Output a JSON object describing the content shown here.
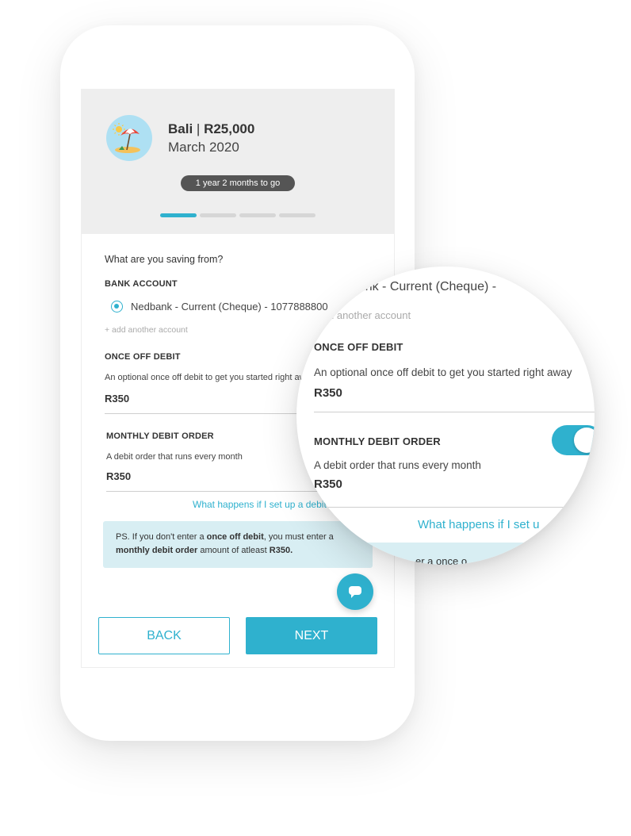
{
  "goal": {
    "name": "Bali",
    "amount": "R25,000",
    "date": "March 2020",
    "time_left": "1 year 2 months to go",
    "icon": "beach-umbrella-icon",
    "progress": {
      "current_step": 1,
      "total_steps": 4
    }
  },
  "form": {
    "question": "What are you saving from?",
    "bank_account": {
      "label": "BANK ACCOUNT",
      "selected": "Nedbank - Current (Cheque) - 1077888800",
      "add_link": "+ add another account"
    },
    "once_off": {
      "label": "ONCE OFF DEBIT",
      "help": "An optional once off debit to get you started right away",
      "value": "R350"
    },
    "monthly": {
      "label": "MONTHLY DEBIT ORDER",
      "help": "A debit order that runs every month",
      "value": "R350",
      "enabled": true
    },
    "info_link": "What happens if I set up a debit order?",
    "note": {
      "prefix": "PS. If you don't enter a ",
      "bold1": "once off debit",
      "middle": ", you must enter a ",
      "bold2": "monthly debit order",
      "suffix": " amount of atleast ",
      "bold3": "R350."
    }
  },
  "buttons": {
    "back": "BACK",
    "next": "NEXT",
    "chat_icon": "chat-bubble-icon"
  },
  "magnifier": {
    "account_fragment": "dbank - Current (Cheque) -",
    "add_fragment": "d another account",
    "link_fragment": "What happens if I set u",
    "note_fragment": "er a once o"
  },
  "colors": {
    "accent": "#2fb1ce",
    "note_bg": "#d8eef3",
    "hero_bg": "#eeeeee",
    "pill_bg": "#555555"
  }
}
